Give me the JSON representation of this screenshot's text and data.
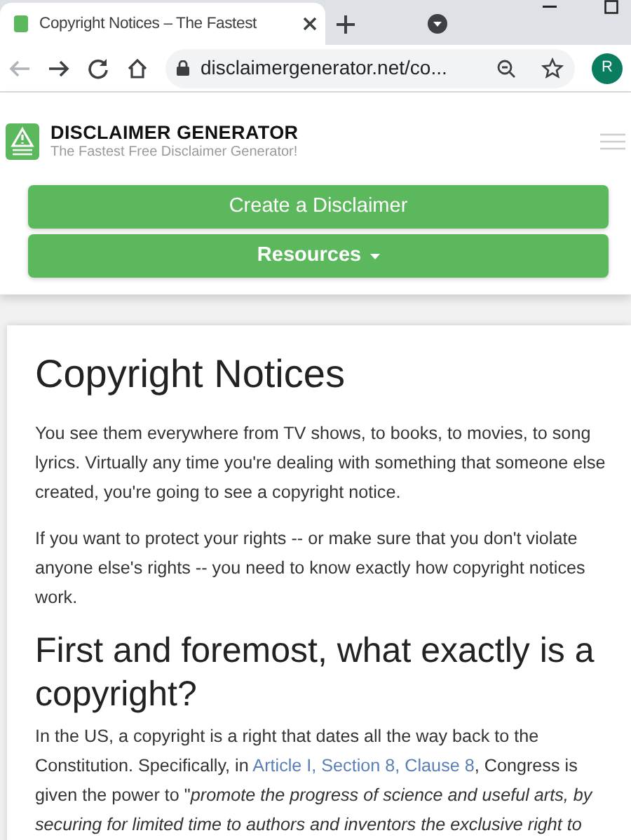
{
  "browser": {
    "tab": {
      "title": "Copyright Notices – The Fastest",
      "selected": true
    },
    "address": "disclaimergenerator.net/co...",
    "profile_initial": "R"
  },
  "site_header": {
    "brand": "DISCLAIMER GENERATOR",
    "tagline": "The Fastest Free Disclaimer Generator!",
    "buttons": [
      {
        "label": "Create a Disclaimer",
        "kind": "plain"
      },
      {
        "label": "Resources",
        "kind": "dropdown"
      }
    ]
  },
  "article": {
    "title": "Copyright Notices",
    "blocks": [
      {
        "kind": "paragraph",
        "parts": [
          {
            "kind": "text",
            "text": "You see them everywhere from TV shows, to books, to movies, to song lyrics. Virtually any time you're dealing with something that someone else created, you're going to see a copyright notice."
          }
        ]
      },
      {
        "kind": "paragraph",
        "parts": [
          {
            "kind": "text",
            "text": "If you want to protect your rights -- or make sure that you don't violate anyone else's rights -- you need to know exactly how copyright notices work."
          }
        ]
      },
      {
        "kind": "heading",
        "text": "First and foremost, what exactly is a copyright?"
      },
      {
        "kind": "paragraph",
        "parts": [
          {
            "kind": "text",
            "text": "In the US, a copyright is a right that dates all the way back to the Constitution. Specifically, in "
          },
          {
            "kind": "link",
            "text": "Article I, Section 8, Clause 8"
          },
          {
            "kind": "text",
            "text": ", Congress is given the power to \""
          },
          {
            "kind": "italic",
            "text": "promote the progress of science and useful arts, by securing for limited time to authors and inventors the exclusive right to"
          }
        ]
      }
    ]
  }
}
